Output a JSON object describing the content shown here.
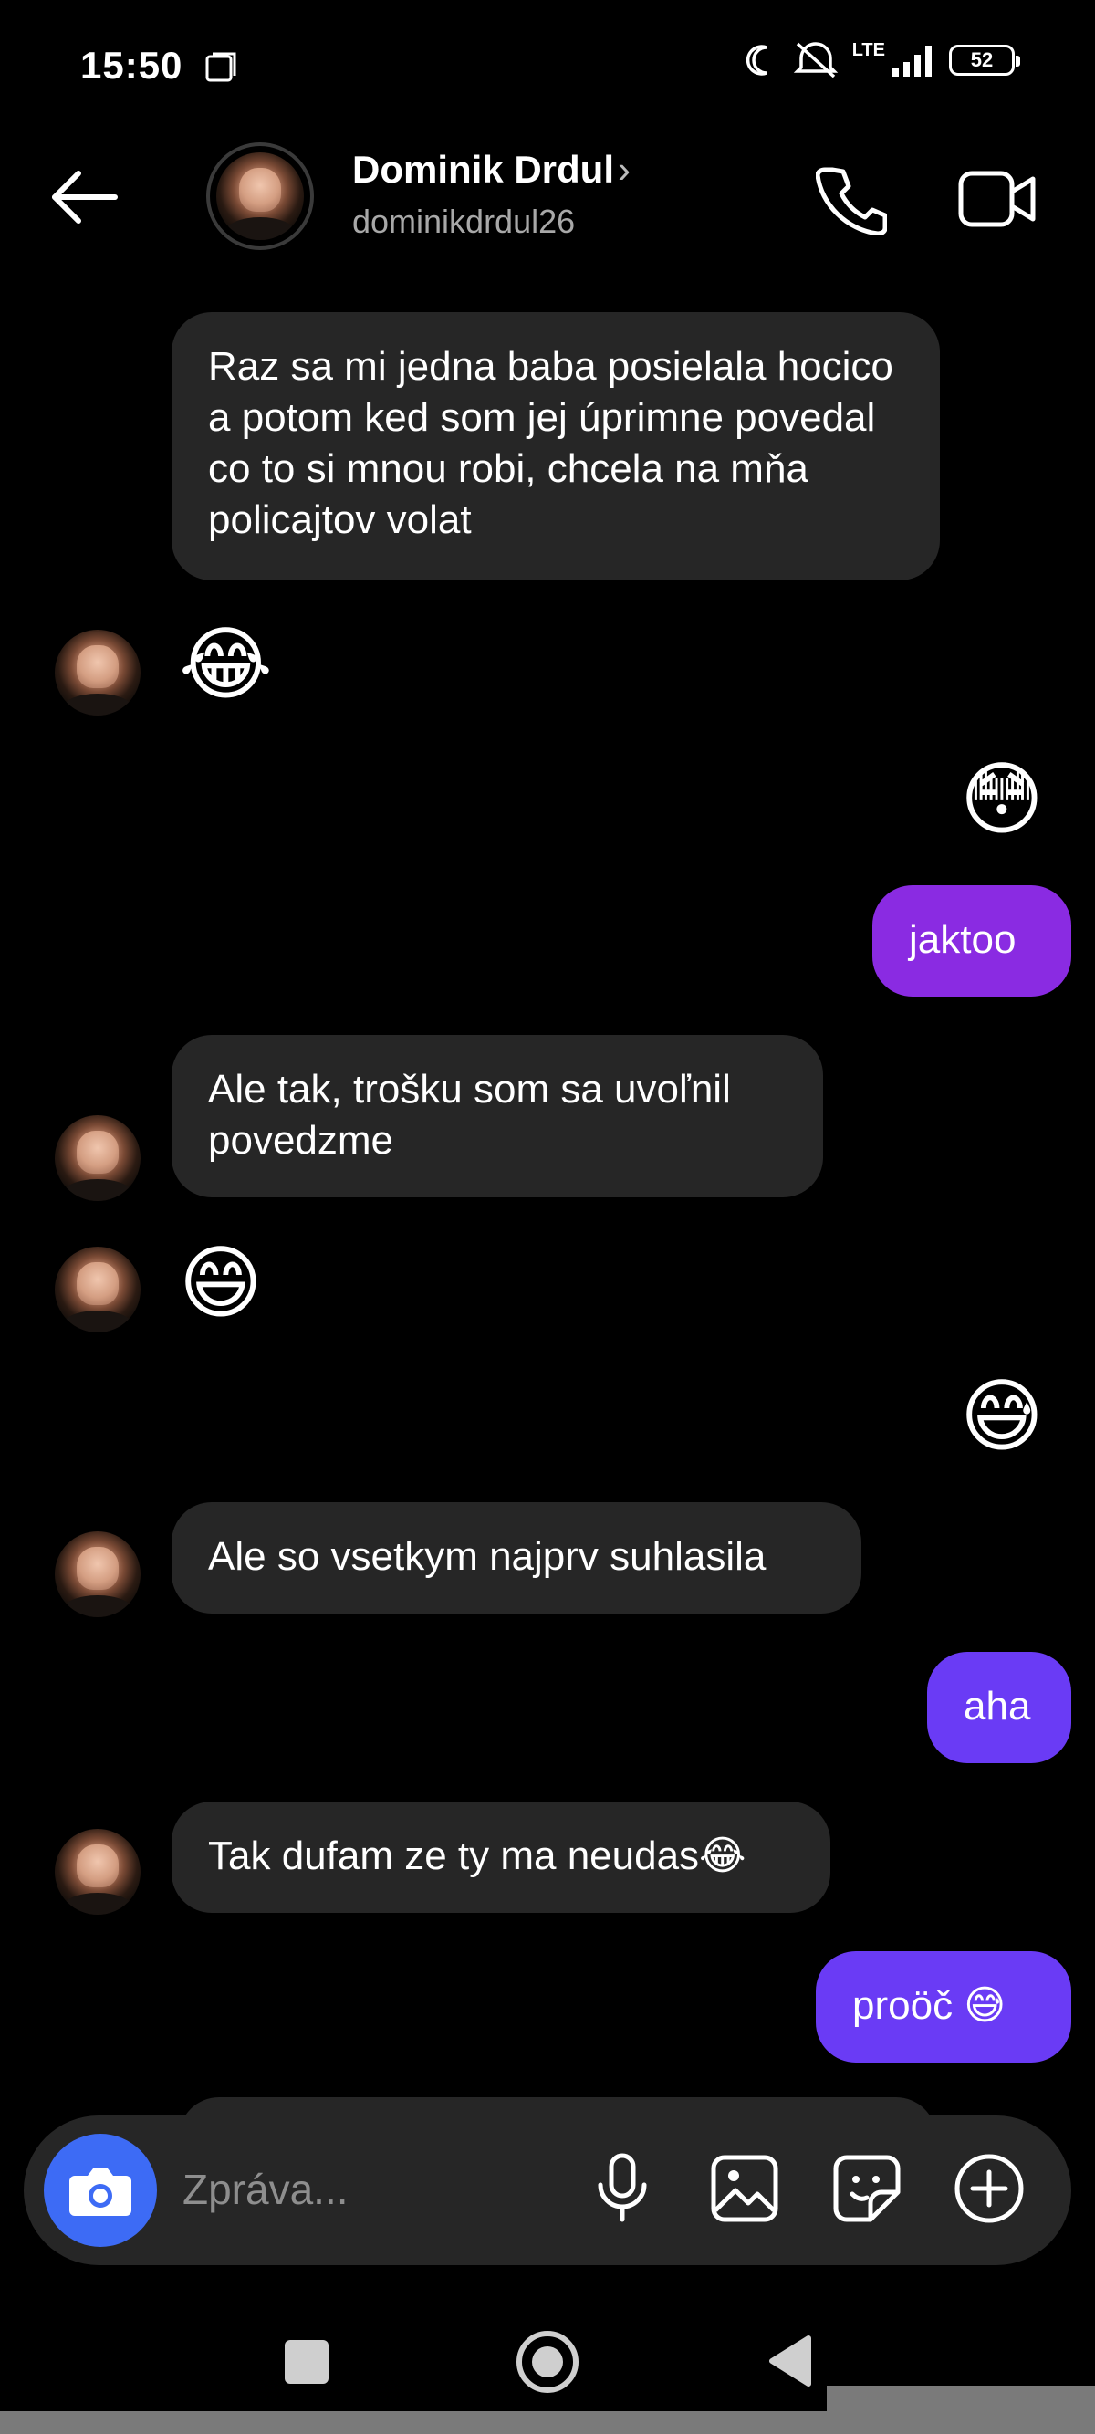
{
  "status_bar": {
    "time": "15:50",
    "network": "LTE",
    "battery": "52"
  },
  "header": {
    "name": "Dominik Drdul",
    "username": "dominikdrdul26",
    "icons": [
      "back-arrow-icon",
      "phone-icon",
      "video-icon"
    ]
  },
  "messages": [
    {
      "side": "in",
      "text": "Raz sa mi jedna baba posielala hocico a potom ked som jej úprimne povedal co to si mnou robi, chcela na mňa policajtov volat"
    },
    {
      "side": "in",
      "emoji": "😂"
    },
    {
      "side": "out",
      "emoji": "😳"
    },
    {
      "side": "out",
      "text": "jaktoo"
    },
    {
      "side": "in",
      "text": "Ale tak, trošku som sa uvoľnil povedzme"
    },
    {
      "side": "in",
      "emoji": "😄"
    },
    {
      "side": "out",
      "emoji": "😅"
    },
    {
      "side": "in",
      "text": "Ale so vsetkym najprv suhlasila"
    },
    {
      "side": "out",
      "text": "aha"
    },
    {
      "side": "in",
      "text": "Tak dufam ze ty ma neudas😂"
    },
    {
      "side": "out",
      "text": "proöč 😅"
    }
  ],
  "composer": {
    "placeholder": "Zpráva...",
    "icons": [
      "camera-icon",
      "microphone-icon",
      "gallery-icon",
      "sticker-icon",
      "add-icon"
    ]
  },
  "colors": {
    "incoming_bubble": "#262626",
    "outgoing_purple": "#8a2be2",
    "outgoing_violet": "#6a3bf5",
    "camera_button": "#3d6bf5"
  }
}
